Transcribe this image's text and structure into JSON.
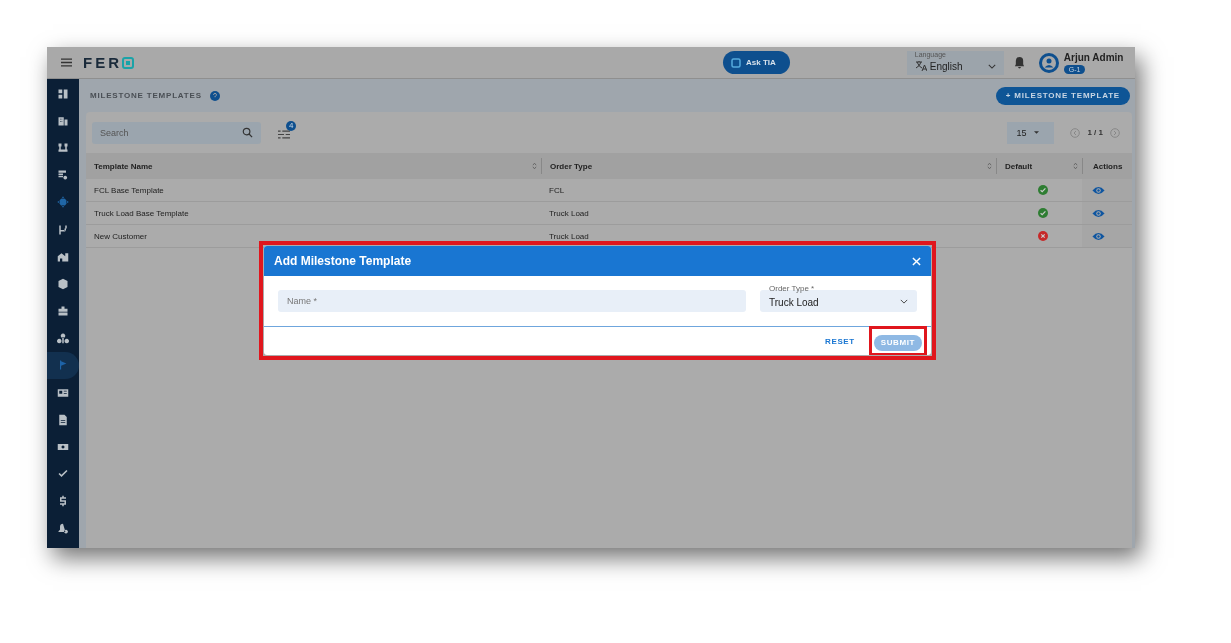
{
  "topbar": {
    "logo": "FER",
    "ask_button": "Ask TIA",
    "language": {
      "label": "Language",
      "value": "English"
    },
    "user": {
      "name": "Arjun Admin",
      "badge": "G-1"
    }
  },
  "sidebar": {
    "items": [
      {
        "selected": false,
        "active": false
      },
      {
        "selected": false,
        "active": false
      },
      {
        "selected": false,
        "active": false
      },
      {
        "selected": false,
        "active": false
      },
      {
        "selected": false,
        "active": true
      },
      {
        "selected": false,
        "active": false
      },
      {
        "selected": false,
        "active": false
      },
      {
        "selected": false,
        "active": false
      },
      {
        "selected": false,
        "active": false
      },
      {
        "selected": false,
        "active": false
      },
      {
        "selected": true,
        "active": false
      },
      {
        "selected": false,
        "active": false
      },
      {
        "selected": false,
        "active": false
      },
      {
        "selected": false,
        "active": false
      },
      {
        "selected": false,
        "active": false
      },
      {
        "selected": false,
        "active": false
      },
      {
        "selected": false,
        "active": false
      }
    ]
  },
  "page": {
    "title": "MILESTONE TEMPLATES",
    "add_button": "+ MILESTONE TEMPLATE"
  },
  "toolbar": {
    "search": {
      "placeholder": "Search"
    },
    "filter_count": "4",
    "page_size": "15",
    "pagination": "1 / 1"
  },
  "table": {
    "columns": [
      {
        "label": "Template Name",
        "sortable": true
      },
      {
        "label": "Order Type",
        "sortable": true
      },
      {
        "label": "Default",
        "sortable": true
      },
      {
        "label": "Actions",
        "sortable": false
      }
    ],
    "rows": [
      {
        "name": "FCL Base Template",
        "order_type": "FCL",
        "default": true
      },
      {
        "name": "Truck Load Base Template",
        "order_type": "Truck Load",
        "default": true
      },
      {
        "name": "New Customer",
        "order_type": "Truck Load",
        "default": false
      }
    ]
  },
  "dialog": {
    "title": "Add Milestone Template",
    "highlighted": true,
    "name_field": {
      "placeholder": "Name *"
    },
    "order_type_field": {
      "label": "Order Type *",
      "value": "Truck Load"
    },
    "reset_button": "RESET",
    "submit_button": {
      "label": "SUBMIT",
      "highlighted": true
    }
  }
}
